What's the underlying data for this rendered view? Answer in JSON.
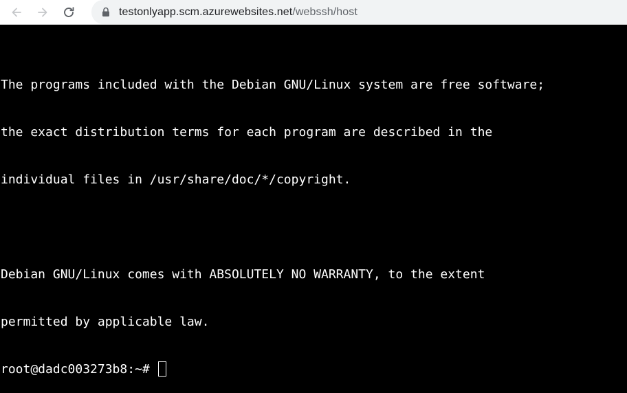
{
  "browser": {
    "url_host": "testonlyapp.scm.azurewebsites.net",
    "url_path": "/webssh/host",
    "icons": [
      "back-arrow-icon",
      "forward-arrow-icon",
      "reload-icon",
      "lock-icon"
    ]
  },
  "terminal": {
    "lines": [
      "The programs included with the Debian GNU/Linux system are free software;",
      "the exact distribution terms for each program are described in the",
      "individual files in /usr/share/doc/*/copyright.",
      "",
      "Debian GNU/Linux comes with ABSOLUTELY NO WARRANTY, to the extent",
      "permitted by applicable law."
    ],
    "prompt": "root@dadc003273b8:~# "
  }
}
